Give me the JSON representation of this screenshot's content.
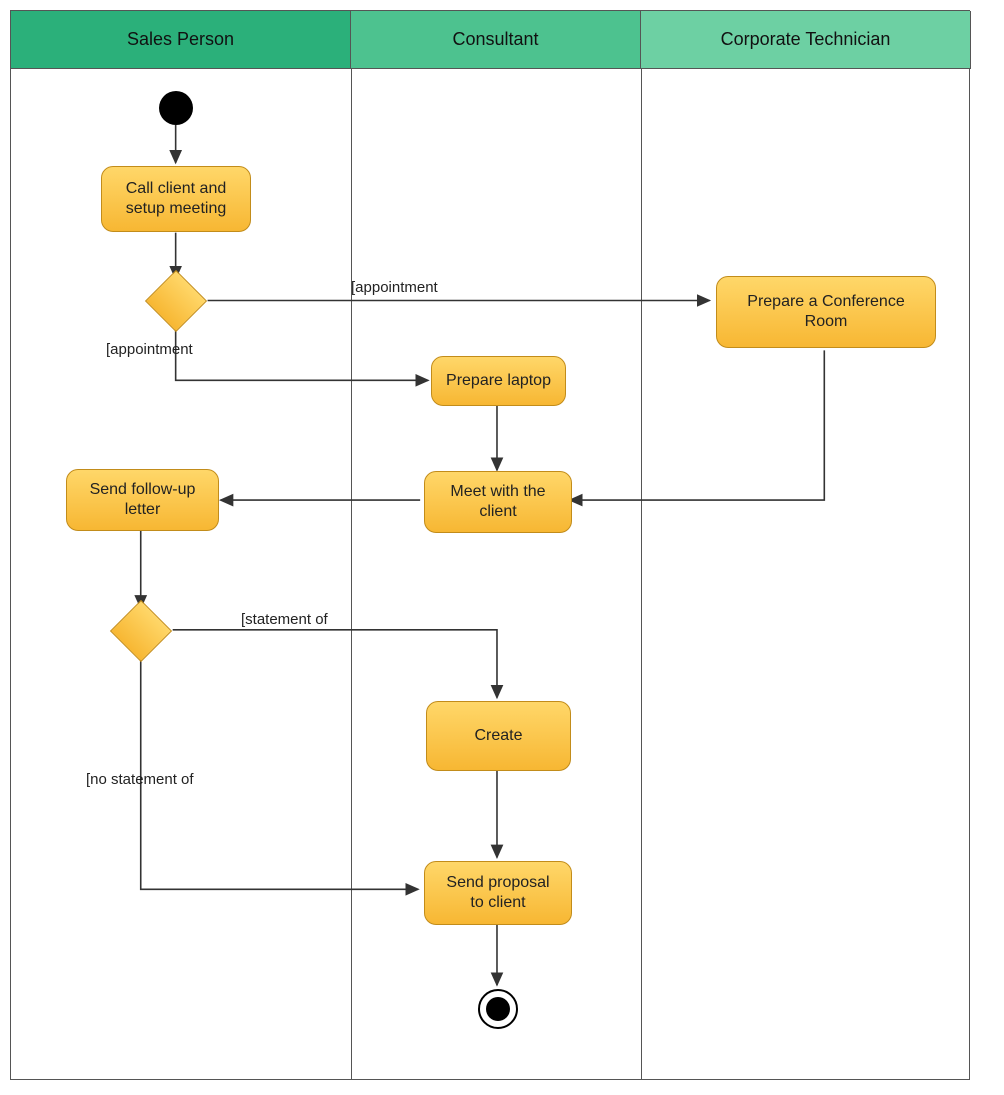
{
  "swimlanes": [
    {
      "title": "Sales Person",
      "bg": "#2bb07a"
    },
    {
      "title": "Consultant",
      "bg": "#4dc28f"
    },
    {
      "title": "Corporate Technician",
      "bg": "#6dd0a3"
    }
  ],
  "activities": {
    "call_client": "Call client and\nsetup meeting",
    "prepare_conf": "Prepare a Conference\nRoom",
    "prepare_laptop": "Prepare laptop",
    "meet_client": "Meet with the\nclient",
    "followup": "Send follow-up\nletter",
    "create": "Create",
    "send_proposal": "Send proposal\nto client"
  },
  "edge_labels": {
    "appt1": "[appointment",
    "appt2": "[appointment",
    "stmt": "[statement of",
    "no_stmt": "[no statement of"
  }
}
